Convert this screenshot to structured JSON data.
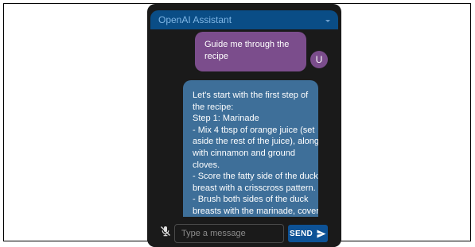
{
  "header": {
    "title": "OpenAI Assistant"
  },
  "messages": {
    "user": {
      "text": "Guide me through the recipe",
      "avatar_letter": "U"
    },
    "assistant": {
      "lines": [
        "Let's start with the first step of",
        "the recipe:",
        "Step 1: Marinade",
        "- Mix 4 tbsp of orange juice (set",
        "aside the rest of the juice), along",
        "with cinnamon and ground",
        "cloves.",
        "- Score the fatty side of the duck",
        "breast with a crisscross pattern.",
        "- Brush both sides of the duck",
        "breasts with the marinade, cover,"
      ]
    }
  },
  "composer": {
    "placeholder": "Type a message",
    "value": "",
    "send_label": "SEND"
  },
  "icons": {
    "mic": "mic-off-icon",
    "send": "send-arrow-icon",
    "header": "chevron-down-icon"
  },
  "colors": {
    "header_bg": "#0a4d86",
    "user_bubble": "#7b4d8c",
    "assistant_bubble": "#3e6f99",
    "panel_bg": "#1a1a1a",
    "send_button": "#0d5296"
  }
}
